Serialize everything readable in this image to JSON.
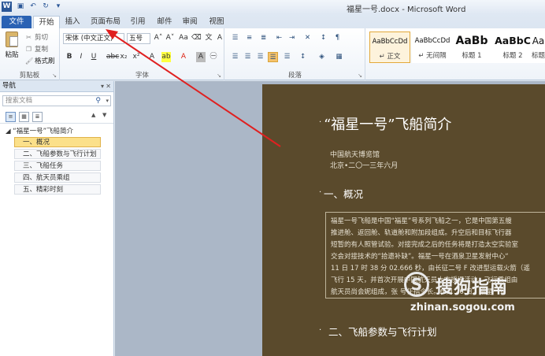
{
  "window": {
    "title": "福星一号.docx - Microsoft Word",
    "app_icon_letter": "W",
    "qat": [
      "save-icon",
      "undo-icon",
      "redo-icon",
      "customize-icon"
    ]
  },
  "tabs": [
    "文件",
    "开始",
    "插入",
    "页面布局",
    "引用",
    "邮件",
    "审阅",
    "视图"
  ],
  "ribbon": {
    "clipboard": {
      "paste": "粘贴",
      "cut": "剪切",
      "copy": "复制",
      "format_painter": "格式刷",
      "group_label": "剪贴板"
    },
    "font": {
      "name": "宋体 (中文正文)",
      "size": "五号",
      "group_label": "字体"
    },
    "paragraph": {
      "group_label": "段落"
    },
    "styles": [
      {
        "preview": "AaBbCcDd",
        "name": "↵ 正文"
      },
      {
        "preview": "AaBbCcDd",
        "name": "↵ 无间隔"
      },
      {
        "preview": "AaBb",
        "name": "标题 1"
      },
      {
        "preview": "AaBbC",
        "name": "标题 2"
      },
      {
        "preview": "Aa",
        "name": "标题"
      }
    ]
  },
  "nav": {
    "title": "导航",
    "search_placeholder": "搜索文档",
    "root": "“福星一号”飞船简介",
    "items": [
      "一、概况",
      "二、飞船参数与飞行计划",
      "三、飞船任务",
      "四、航天员乘组",
      "五、精彩时刻"
    ],
    "selected_index": 0
  },
  "document": {
    "title": "“福星一号”飞船简介",
    "author": "中国航天博览馆",
    "date": "北京•二〇一三年六月",
    "section1": "一、概况",
    "body": [
      "福星一号飞船是中国“福星”号系列飞船之一，它是中国第五艘",
      "推进舱、返回舱、轨道舱和附加段组成。升空后和目标飞行器",
      "短暂的有人照管试验。对接完成之后的任务将是打造太空实验室",
      "交会对接技术的“拾遗补缺”。福星一号在酒泉卫星发射中心“",
      "11 日 17 时 38 分 02.666 秒，由长征二号 F 改进型运载火箭（遥",
      "飞行 15 天，并首次开展中国航天员太空授课活动。飞行乘组由",
      "航天员尚会妮组成，张    号任指令长。6 月 26 日，福星一号"
    ],
    "section2": "二、飞船参数与飞行计划"
  },
  "watermark": {
    "text": "搜狗指南",
    "url": "zhinan.sogou.com"
  }
}
